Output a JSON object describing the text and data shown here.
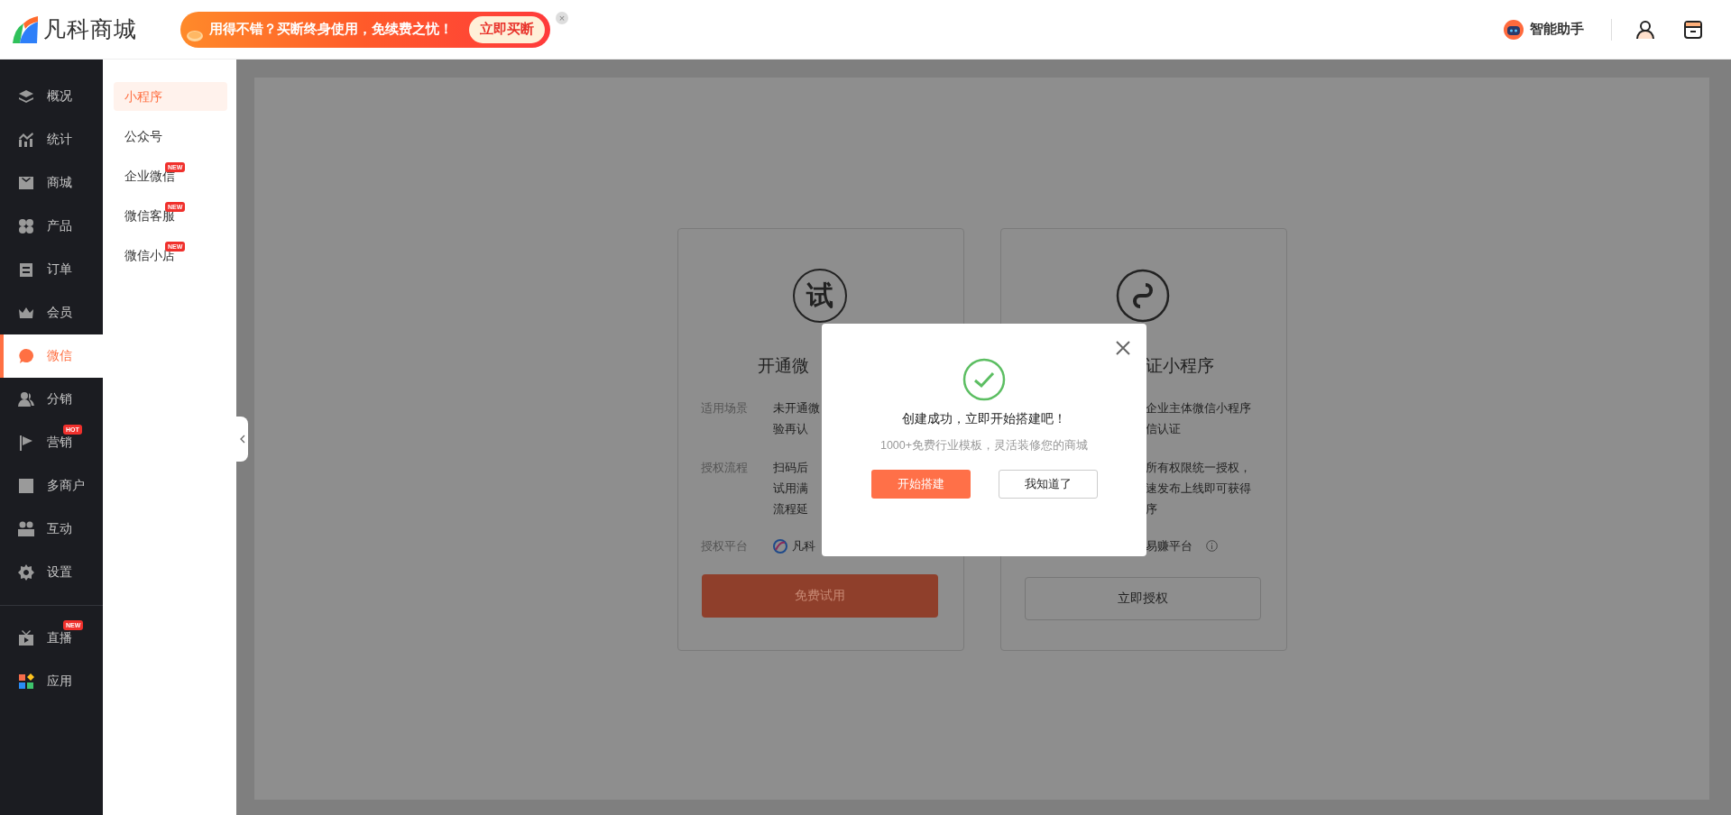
{
  "header": {
    "logo": "凡科商城",
    "promo": {
      "text": "用得不错？买断终身使用，免续费之忧！",
      "button": "立即买断",
      "close": "×"
    },
    "assistant": "智能助手"
  },
  "sidebar": {
    "groups": [
      [
        {
          "label": "概况",
          "selected": false
        },
        {
          "label": "统计",
          "selected": false
        },
        {
          "label": "商城",
          "selected": false
        },
        {
          "label": "产品",
          "selected": false
        },
        {
          "label": "订单",
          "selected": false
        },
        {
          "label": "会员",
          "selected": false
        },
        {
          "label": "微信",
          "selected": true
        },
        {
          "label": "分销",
          "selected": false
        },
        {
          "label": "营销",
          "selected": false,
          "badge": "HOT"
        },
        {
          "label": "多商户",
          "selected": false
        },
        {
          "label": "互动",
          "selected": false
        },
        {
          "label": "设置",
          "selected": false
        }
      ],
      [
        {
          "label": "直播",
          "selected": false,
          "badge": "NEW"
        },
        {
          "label": "应用",
          "selected": false
        }
      ]
    ]
  },
  "submenu": {
    "items": [
      {
        "label": "小程序",
        "selected": true
      },
      {
        "label": "公众号",
        "selected": false
      },
      {
        "label": "企业微信",
        "selected": false,
        "badge": "NEW"
      },
      {
        "label": "微信客服",
        "selected": false,
        "badge": "NEW"
      },
      {
        "label": "微信小店",
        "selected": false,
        "badge": "NEW"
      }
    ]
  },
  "cards": [
    {
      "kind": "trial",
      "icon_text": "试",
      "title": "开通微",
      "rows": [
        {
          "label": "适用场景",
          "lines": [
            "未开通微",
            "验再认"
          ]
        },
        {
          "label": "授权流程",
          "lines": [
            "扫码后",
            "试用满",
            "流程延"
          ]
        }
      ],
      "platform": {
        "label": "授权平台",
        "name": "凡科",
        "info": false
      },
      "button": "免费试用"
    },
    {
      "kind": "authorize",
      "title": "证小程序",
      "rows": [
        {
          "lines": [
            "企业主体微信小程序",
            "信认证"
          ]
        },
        {
          "lines": [
            "所有权限统一授权，",
            "速发布上线即可获得",
            "序"
          ]
        }
      ],
      "platform": {
        "name": "易赚平台",
        "info": true
      },
      "button": "立即授权"
    }
  ],
  "dialog": {
    "title": "创建成功，立即开始搭建吧！",
    "subtitle": "1000+免费行业模板，灵活装修您的商城",
    "buttons": [
      {
        "label": "开始搭建",
        "kind": "primary"
      },
      {
        "label": "我知道了",
        "kind": "default"
      }
    ]
  }
}
